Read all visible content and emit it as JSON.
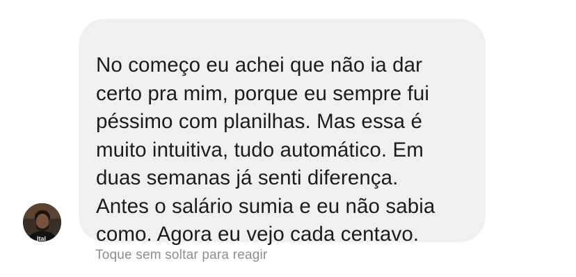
{
  "conversation": {
    "message": {
      "lines": [
        "No começo eu achei que não ia dar",
        "certo pra mim, porque eu sempre fui",
        "péssimo com planilhas. Mas essa é",
        "muito intuitiva, tudo automático. Em",
        "duas semanas já senti diferença.",
        "Antes o salário sumia e eu não sabia",
        "como. Agora eu vejo cada centavo."
      ],
      "bubble_color": "#f0f0f0",
      "text_color": "#1c1c1c"
    },
    "avatar": {
      "icon": "user-avatar-photo",
      "shirt_text": "Ital"
    },
    "reaction_hint": "Toque sem soltar para reagir"
  }
}
